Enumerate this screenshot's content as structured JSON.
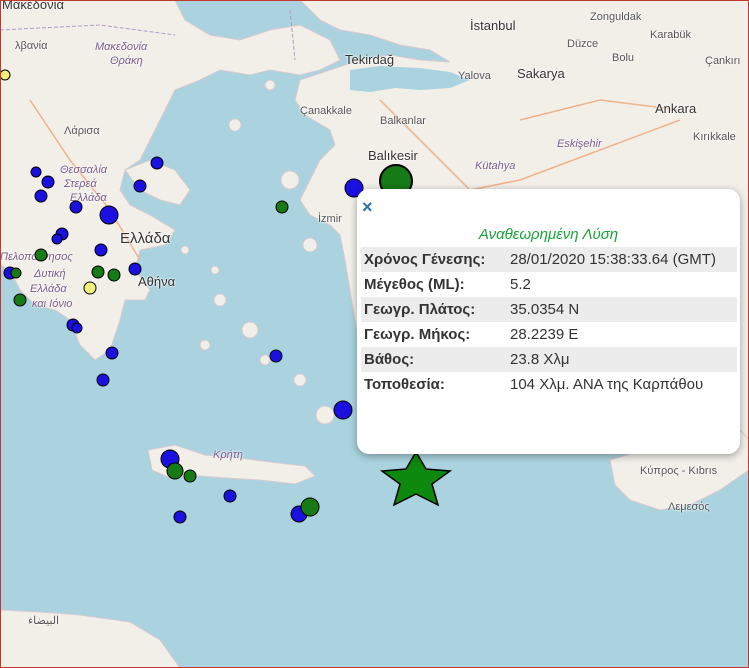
{
  "map": {
    "labels": {
      "makedonia_top": "Μακεδονία",
      "makedonia_thraki_1": "Μακεδονία",
      "makedonia_thraki_2": "Θράκη",
      "alvania": "λβανία",
      "larisa": "Λάρισα",
      "thessalia_1": "Θεσσαλία",
      "thessalia_2": "Στερεά",
      "thessalia_3": "Ελλάδα",
      "ellada": "Ελλάδα",
      "peloponnisos_1": "Πελοπόννησος",
      "peloponnisos_2": "Δυτική",
      "peloponnisos_3": "Ελλάδα",
      "peloponnisos_4": "και Ιόνιο",
      "athina": "Αθήνα",
      "kriti": "Κρήτη",
      "tekirdag": "Tekirdağ",
      "istanbul": "İstanbul",
      "duzce": "Düzce",
      "bolu": "Bolu",
      "zonguldak": "Zonguldak",
      "karabuk": "Karabük",
      "cankiri": "Çankırı",
      "yalova": "Yalova",
      "sakarya": "Sakarya",
      "ankara": "Ankara",
      "kirikkale": "Kırıkkale",
      "canakkale": "Çanakkale",
      "balkanlar": "Balkanlar",
      "balikesir": "Balıkesir",
      "kutahya": "Kütahya",
      "eskisehir": "Eskişehir",
      "izmir": "İzmir",
      "kypros": "Κύπρος - Kıbrıs",
      "lemesos": "Λεμεσός"
    },
    "attribution_bottom": "البيضاء"
  },
  "popup": {
    "close_label": "×",
    "title": "Αναθεωρημένη Λύση",
    "rows": [
      {
        "key": "Χρόνος Γένεσης:",
        "value": "28/01/2020 15:38:33.64 (GMT)"
      },
      {
        "key": "Μέγεθος (ML):",
        "value": "5.2"
      },
      {
        "key": "Γεωγρ. Πλάτος:",
        "value": "35.0354 N"
      },
      {
        "key": "Γεωγρ. Μήκος:",
        "value": "28.2239 E"
      },
      {
        "key": "Βάθος:",
        "value": "23.8 Χλμ"
      },
      {
        "key": "Τοποθεσία:",
        "value": "104 Χλμ. ΑΝΑ της Καρπάθου"
      }
    ]
  },
  "colors": {
    "sea": "#aad3df",
    "land": "#f2efe9",
    "quake_blue": "#1a10e0",
    "quake_green": "#167a16",
    "quake_yellow": "#f5f07a",
    "main_event": "#0d8a0d",
    "popup_title": "#19a33a"
  },
  "markers": {
    "main_event_icon": "star-icon"
  }
}
